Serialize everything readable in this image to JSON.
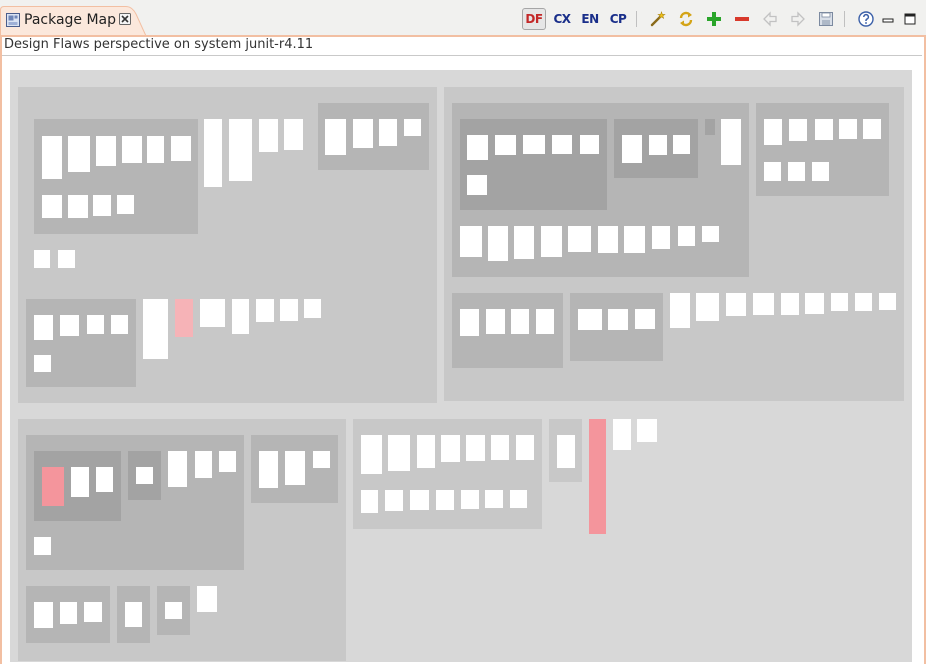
{
  "tab": {
    "title": "Package Map",
    "icon": "package-map-icon",
    "close_icon": "close-icon"
  },
  "toolbar": {
    "df_label": "DF",
    "cx_label": "CX",
    "en_label": "EN",
    "cp_label": "CP",
    "icons": [
      "wand-icon",
      "refresh-icon",
      "zoom-in-plus-icon",
      "zoom-out-minus-icon",
      "back-arrow-icon",
      "forward-arrow-icon",
      "save-icon",
      "help-icon",
      "minimize-icon",
      "maximize-icon"
    ]
  },
  "subtitle": "Design Flaws perspective on system junit-r4.11",
  "colors": {
    "tab_border": "#f2bfa2",
    "package_level1": "#d8d8d8",
    "package_level2": "#c8c8c8",
    "package_level3": "#b5b5b5",
    "package_level4": "#a3a3a3",
    "class_normal": "#ffffff",
    "class_flawed": "#f4959c",
    "class_flawed_light": "#f6b3b7"
  }
}
